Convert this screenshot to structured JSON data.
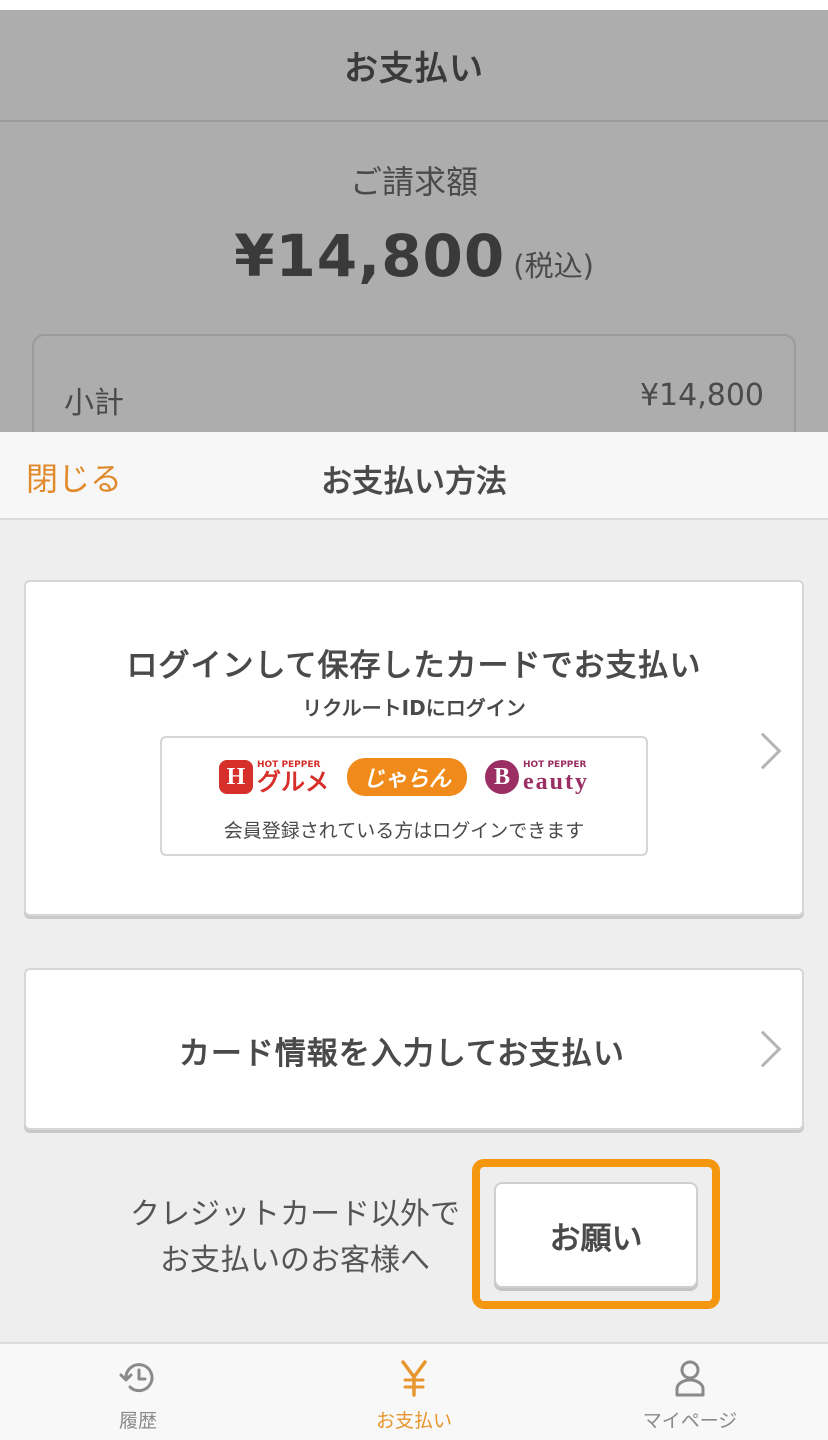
{
  "background": {
    "header_title": "お支払い",
    "billing_label": "ご請求額",
    "total_amount": "¥14,800",
    "total_tax": "(税込)",
    "subtotal_label": "小計",
    "subtotal_value": "¥14,800"
  },
  "sheet": {
    "close_label": "閉じる",
    "title": "お支払い方法",
    "login_card": {
      "title": "ログインして保存したカードでお支払い",
      "subtitle": "リクルートIDにログイン",
      "logos": {
        "gourmet_mark": "H",
        "gourmet_small": "HOT PEPPER",
        "gourmet_name": "グルメ",
        "jalan_name": "じゃらん",
        "beauty_mark": "B",
        "beauty_small": "HOT PEPPER",
        "beauty_name": "eauty"
      },
      "caption": "会員登録されている方はログインできます"
    },
    "input_card": {
      "title": "カード情報を入力してお支払い"
    },
    "other_text_line1": "クレジットカード以外で",
    "other_text_line2": "お支払いのお客様へ",
    "request_button": "お願い"
  },
  "tabbar": {
    "items": [
      {
        "label": "履歴",
        "icon": "history-icon"
      },
      {
        "label": "お支払い",
        "icon": "yen-icon",
        "active": true
      },
      {
        "label": "マイページ",
        "icon": "person-icon"
      }
    ]
  },
  "colors": {
    "accent": "#e08a2c",
    "highlight": "#f5960f",
    "overlay": "#adadad"
  }
}
